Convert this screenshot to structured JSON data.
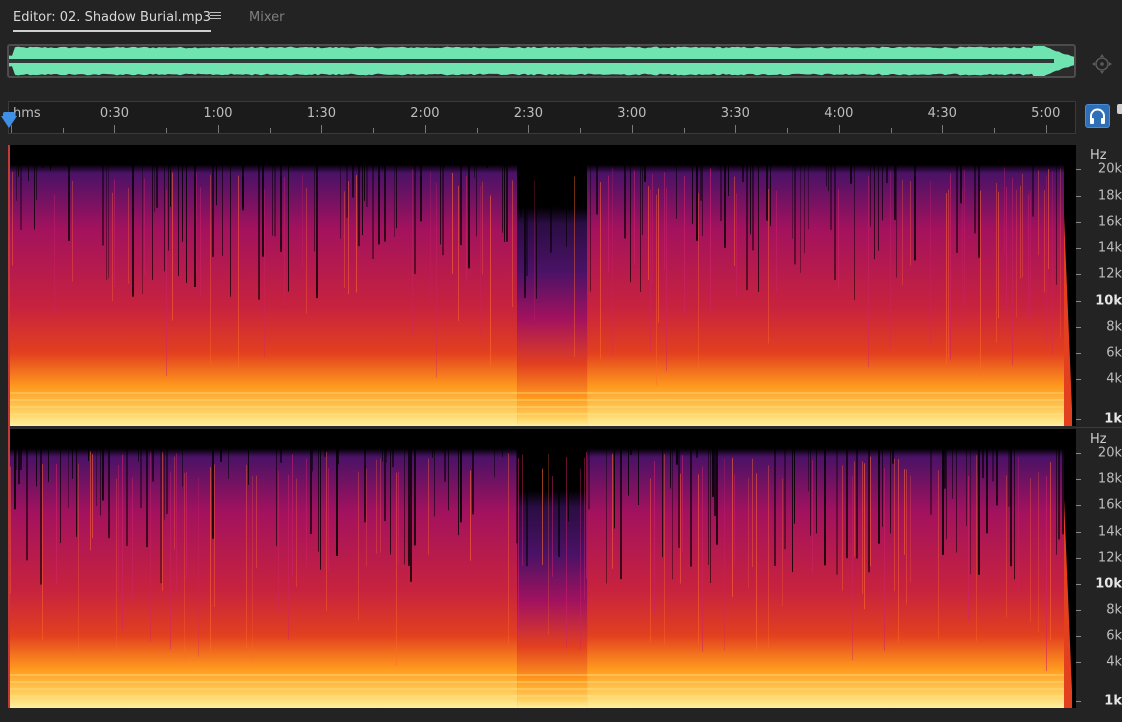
{
  "tabs": {
    "editor_label": "Editor: 02. Shadow Burial.mp3",
    "mixer_label": "Mixer",
    "menu_icon": "hamburger-menu-icon"
  },
  "overview": {
    "waveform_color": "#6fe3b0",
    "nav_icon": "zoom-navigator-icon"
  },
  "ruler": {
    "unit_label": "hms",
    "time_labels": [
      "0:30",
      "1:00",
      "1:30",
      "2:00",
      "2:30",
      "3:00",
      "3:30",
      "4:00",
      "4:30",
      "5:00"
    ],
    "total_seconds": 305,
    "playhead_seconds": 0,
    "monitor_icon": "headphones-icon"
  },
  "spectral": {
    "unit_label": "Hz",
    "frequency_labels": [
      {
        "text": "20k",
        "hz": 20000,
        "bold": false
      },
      {
        "text": "18k",
        "hz": 18000,
        "bold": false
      },
      {
        "text": "16k",
        "hz": 16000,
        "bold": false
      },
      {
        "text": "14k",
        "hz": 14000,
        "bold": false
      },
      {
        "text": "12k",
        "hz": 12000,
        "bold": false
      },
      {
        "text": "10k",
        "hz": 10000,
        "bold": true
      },
      {
        "text": "8k",
        "hz": 8000,
        "bold": false
      },
      {
        "text": "6k",
        "hz": 6000,
        "bold": false
      },
      {
        "text": "4k",
        "hz": 4000,
        "bold": false
      },
      {
        "text": "1k",
        "hz": 1000,
        "bold": true
      }
    ],
    "channels": 2,
    "colors": {
      "low": "#fff0a0",
      "mid_hot": "#ff9a1e",
      "mid": "#e2401f",
      "high": "#a3125e",
      "top": "#4a1266",
      "background": "#000000"
    },
    "quiet_section_start_seconds": 147
  }
}
